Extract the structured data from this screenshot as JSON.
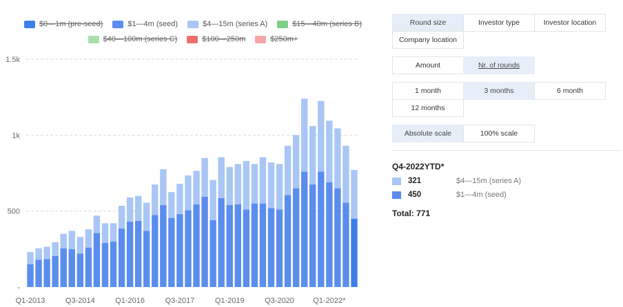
{
  "chart_data": {
    "type": "bar",
    "stacked": true,
    "ylim": [
      0,
      1500
    ],
    "yticks": [
      {
        "v": 0,
        "label": "-"
      },
      {
        "v": 500,
        "label": "500"
      },
      {
        "v": 1000,
        "label": "1k"
      },
      {
        "v": 1500,
        "label": "1.5k"
      }
    ],
    "categories": [
      "Q1-2013",
      "Q2-2013",
      "Q3-2013",
      "Q4-2013",
      "Q1-2014",
      "Q2-2014",
      "Q3-2014",
      "Q4-2014",
      "Q1-2015",
      "Q2-2015",
      "Q3-2015",
      "Q4-2015",
      "Q1-2016",
      "Q2-2016",
      "Q3-2016",
      "Q4-2016",
      "Q1-2017",
      "Q2-2017",
      "Q3-2017",
      "Q4-2017",
      "Q1-2018",
      "Q2-2018",
      "Q3-2018",
      "Q4-2018",
      "Q1-2019",
      "Q2-2019",
      "Q3-2019",
      "Q4-2019",
      "Q1-2020",
      "Q2-2020",
      "Q3-2020",
      "Q4-2020",
      "Q1-2021",
      "Q2-2021",
      "Q3-2021",
      "Q4-2021",
      "Q1-2022",
      "Q2-2022",
      "Q3-2022",
      "Q4-2022YTD*"
    ],
    "xtick_labels": [
      "Q1-2013",
      "Q3-2014",
      "Q1-2016",
      "Q3-2017",
      "Q1-2019",
      "Q3-2020",
      "Q1-2022*"
    ],
    "xtick_every": 6,
    "series": [
      {
        "name": "$1—4m (seed)",
        "color": "#5b8def",
        "values": [
          150,
          180,
          185,
          205,
          255,
          250,
          220,
          260,
          355,
          290,
          300,
          385,
          430,
          435,
          370,
          475,
          540,
          455,
          480,
          505,
          545,
          595,
          440,
          585,
          540,
          545,
          510,
          550,
          550,
          520,
          510,
          605,
          650,
          760,
          675,
          760,
          690,
          650,
          555,
          450
        ]
      },
      {
        "name": "$4—15m (series A)",
        "color": "#a9c6f5",
        "values": [
          80,
          75,
          80,
          90,
          95,
          120,
          110,
          120,
          115,
          130,
          120,
          150,
          160,
          165,
          185,
          200,
          235,
          170,
          200,
          230,
          220,
          255,
          265,
          270,
          250,
          265,
          320,
          260,
          305,
          300,
          300,
          325,
          350,
          480,
          385,
          465,
          405,
          395,
          375,
          321
        ]
      }
    ]
  },
  "legend": [
    {
      "label": "$0—1m (pre-seed)",
      "color": "#3d7fe8",
      "off": true
    },
    {
      "label": "$1—4m (seed)",
      "color": "#5b8def",
      "off": false
    },
    {
      "label": "$4—15m (series A)",
      "color": "#a9c6f5",
      "off": false
    },
    {
      "label": "$15—40m (series B)",
      "color": "#7ccf87",
      "off": true
    },
    {
      "label": "$40—100m (series C)",
      "color": "#a8e0ad",
      "off": true
    },
    {
      "label": "$100—250m",
      "color": "#ee6d6d",
      "off": true
    },
    {
      "label": "$250m+",
      "color": "#f5a5a5",
      "off": true
    }
  ],
  "controls": {
    "group_by": [
      {
        "label": "Round size",
        "active": true
      },
      {
        "label": "Investor type",
        "active": false
      },
      {
        "label": "Investor location",
        "active": false
      },
      {
        "label": "Company location",
        "active": false
      }
    ],
    "metric": [
      {
        "label": "Amount",
        "active": false
      },
      {
        "label": "Nr. of rounds",
        "active": true
      }
    ],
    "period": [
      {
        "label": "1 month",
        "active": false
      },
      {
        "label": "3 months",
        "active": true
      },
      {
        "label": "6 month",
        "active": false
      },
      {
        "label": "12 months",
        "active": false
      }
    ],
    "scale": [
      {
        "label": "Absolute scale",
        "active": true
      },
      {
        "label": "100% scale",
        "active": false
      }
    ]
  },
  "tooltip": {
    "period": "Q4-2022YTD*",
    "rows": [
      {
        "value": "321",
        "name": "$4—15m (series A)",
        "color": "#a9c6f5"
      },
      {
        "value": "450",
        "name": "$1—4m (seed)",
        "color": "#5b8def"
      }
    ],
    "total": "Total: 771"
  }
}
